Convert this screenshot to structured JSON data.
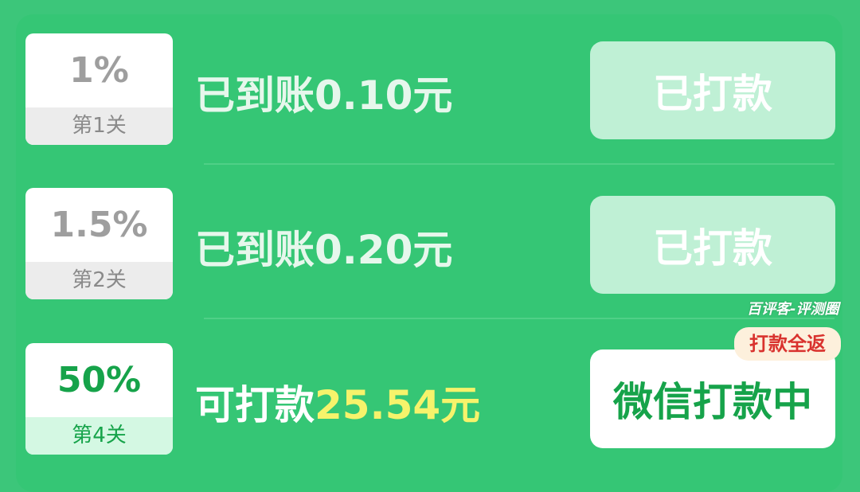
{
  "rows": [
    {
      "percent": "1%",
      "level": "第1关",
      "status": "已到账0.10元",
      "button_label": "已打款"
    },
    {
      "percent": "1.5%",
      "level": "第2关",
      "status": "已到账0.20元",
      "button_label": "已打款"
    },
    {
      "percent": "50%",
      "level": "第4关",
      "status_prefix": "可打款",
      "amount": "25.54元",
      "button_label": "微信打款中",
      "tag": "打款全返"
    }
  ],
  "watermark": "百评客-评测圈",
  "colors": {
    "background": "#3cc67a",
    "accent_green": "#16a34a",
    "amount_yellow": "#f6f36b",
    "tag_red": "#d9322e",
    "paid_button": "#bff0d5"
  }
}
